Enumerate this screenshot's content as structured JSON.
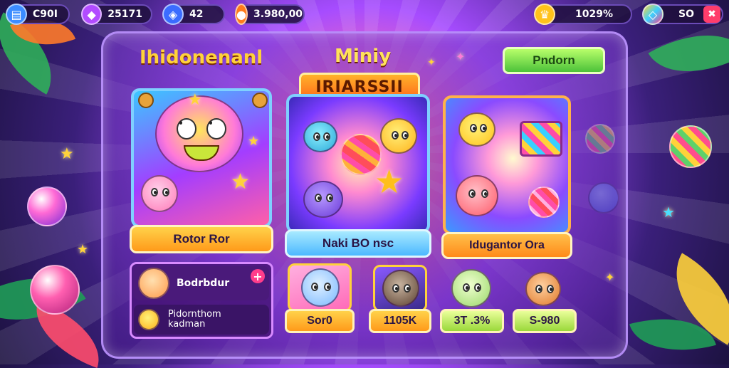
{
  "topbar": {
    "left": [
      {
        "value": "C90I",
        "icon": "book-icon",
        "color": "#3b8cff"
      },
      {
        "value": "25171",
        "icon": "gem-purple-icon",
        "color": "#b24cff"
      },
      {
        "value": "42",
        "icon": "gem-blue-icon",
        "color": "#3a6cff"
      },
      {
        "value": "3.980,00",
        "icon": "coin-icon",
        "color": "#ff7a1a"
      }
    ],
    "right": [
      {
        "value": "1029%",
        "icon": "trophy-icon",
        "color": "#ffc21a"
      },
      {
        "value": "SO",
        "icon": "crystal-icon",
        "color": "#ff3d8b"
      }
    ]
  },
  "panel": {
    "left_title": "Ihidonenanl",
    "center_title_top": "Miniy",
    "center_title_banner": "IRIARSSII",
    "top_right_button": "Pndorn"
  },
  "cards": [
    {
      "button": "Rotor Ror",
      "color": "#ffae2a"
    },
    {
      "button": "Naki BO nsc",
      "color": "#6fd0ff"
    },
    {
      "button": "Idugantor Ora",
      "color": "#ff9a2a"
    }
  ],
  "bottom_left": {
    "row1": "Bodrbdur",
    "row2_line1": "Pidornthom",
    "row2_line2": "kadman"
  },
  "shop": [
    {
      "price": "Sor0",
      "color": "#ffb02a"
    },
    {
      "price": "1105K",
      "color": "#ffb02a"
    },
    {
      "price": "3T .3%",
      "color": "#b6f25a"
    },
    {
      "price": "S-980",
      "color": "#b6f25a"
    }
  ]
}
